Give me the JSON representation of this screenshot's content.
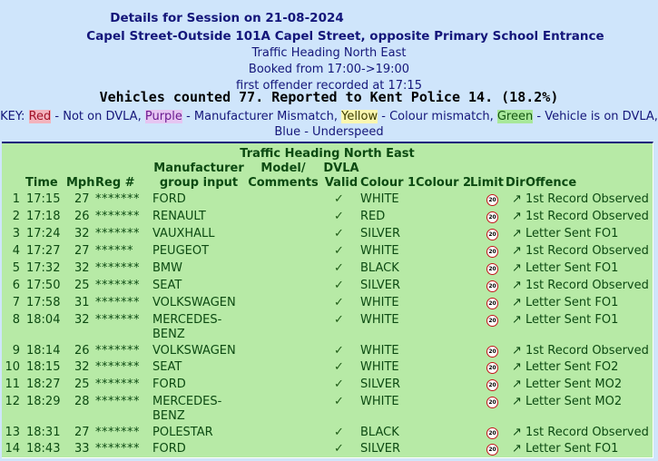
{
  "header": {
    "title": "Details for Session on 21-08-2024",
    "location": "Capel Street-Outside 101A Capel Street, opposite Primary School Entrance",
    "direction": "Traffic Heading North East",
    "booked": "Booked from 17:00->19:00",
    "first_offender": "first offender recorded at 17:15",
    "summary": "Vehicles counted 77.  Reported to Kent Police 14. (18.2%)"
  },
  "key": {
    "prefix": "KEY:",
    "red": "Red",
    "red_desc": "- Not on DVLA,",
    "purple": "Purple",
    "purple_desc": "- Manufacturer Mismatch,",
    "yellow": "Yellow",
    "yellow_desc": "- Colour mismatch,",
    "green": "Green",
    "green_desc": "- Vehicle is on DVLA,",
    "blue": "Blue",
    "blue_desc": "- Underspeed"
  },
  "table": {
    "title": "Traffic Heading North East",
    "headers": {
      "time": "Time",
      "mph": "Mph",
      "reg": "Reg #",
      "manufacturer": "Manufacturer group input",
      "model": "Model/ Comments",
      "dvla": "DVLA Valid",
      "colour1": "Colour 1",
      "colour2": "Colour 2",
      "limit": "Limit",
      "dir": "Dir",
      "offence": "Offence"
    },
    "limit_sign": "20",
    "valid_mark": "✓",
    "dir_mark": "↗",
    "rows": [
      {
        "n": "1",
        "time": "17:15",
        "mph": "27",
        "reg": "*******",
        "man": "FORD",
        "col": "WHITE",
        "off": "1st Record Observed"
      },
      {
        "n": "2",
        "time": "17:18",
        "mph": "26",
        "reg": "*******",
        "man": "RENAULT",
        "col": "RED",
        "off": "1st Record Observed"
      },
      {
        "n": "3",
        "time": "17:24",
        "mph": "32",
        "reg": "*******",
        "man": "VAUXHALL",
        "col": "SILVER",
        "off": "Letter Sent FO1"
      },
      {
        "n": "4",
        "time": "17:27",
        "mph": "27",
        "reg": "******",
        "man": "PEUGEOT",
        "col": "WHITE",
        "off": "1st Record Observed"
      },
      {
        "n": "5",
        "time": "17:32",
        "mph": "32",
        "reg": "*******",
        "man": "BMW",
        "col": "BLACK",
        "off": "Letter Sent FO1"
      },
      {
        "n": "6",
        "time": "17:50",
        "mph": "25",
        "reg": "*******",
        "man": "SEAT",
        "col": "SILVER",
        "off": "1st Record Observed"
      },
      {
        "n": "7",
        "time": "17:58",
        "mph": "31",
        "reg": "*******",
        "man": "VOLKSWAGEN",
        "col": "WHITE",
        "off": "Letter Sent FO1"
      },
      {
        "n": "8",
        "time": "18:04",
        "mph": "32",
        "reg": "*******",
        "man": "MERCEDES-",
        "man2": "BENZ",
        "col": "WHITE",
        "off": "Letter Sent FO1"
      },
      {
        "n": "9",
        "time": "18:14",
        "mph": "26",
        "reg": "*******",
        "man": "VOLKSWAGEN",
        "col": "WHITE",
        "off": "1st Record Observed"
      },
      {
        "n": "10",
        "time": "18:15",
        "mph": "32",
        "reg": "*******",
        "man": "SEAT",
        "col": "WHITE",
        "off": "Letter Sent FO2"
      },
      {
        "n": "11",
        "time": "18:27",
        "mph": "25",
        "reg": "*******",
        "man": "FORD",
        "col": "SILVER",
        "off": "Letter Sent MO2"
      },
      {
        "n": "12",
        "time": "18:29",
        "mph": "28",
        "reg": "*******",
        "man": "MERCEDES-",
        "man2": "BENZ",
        "col": "WHITE",
        "off": "Letter Sent MO2"
      },
      {
        "n": "13",
        "time": "18:31",
        "mph": "27",
        "reg": "*******",
        "man": "POLESTAR",
        "col": "BLACK",
        "off": "1st Record Observed"
      },
      {
        "n": "14",
        "time": "18:43",
        "mph": "33",
        "reg": "*******",
        "man": "FORD",
        "col": "SILVER",
        "off": "Letter Sent FO1"
      }
    ]
  }
}
